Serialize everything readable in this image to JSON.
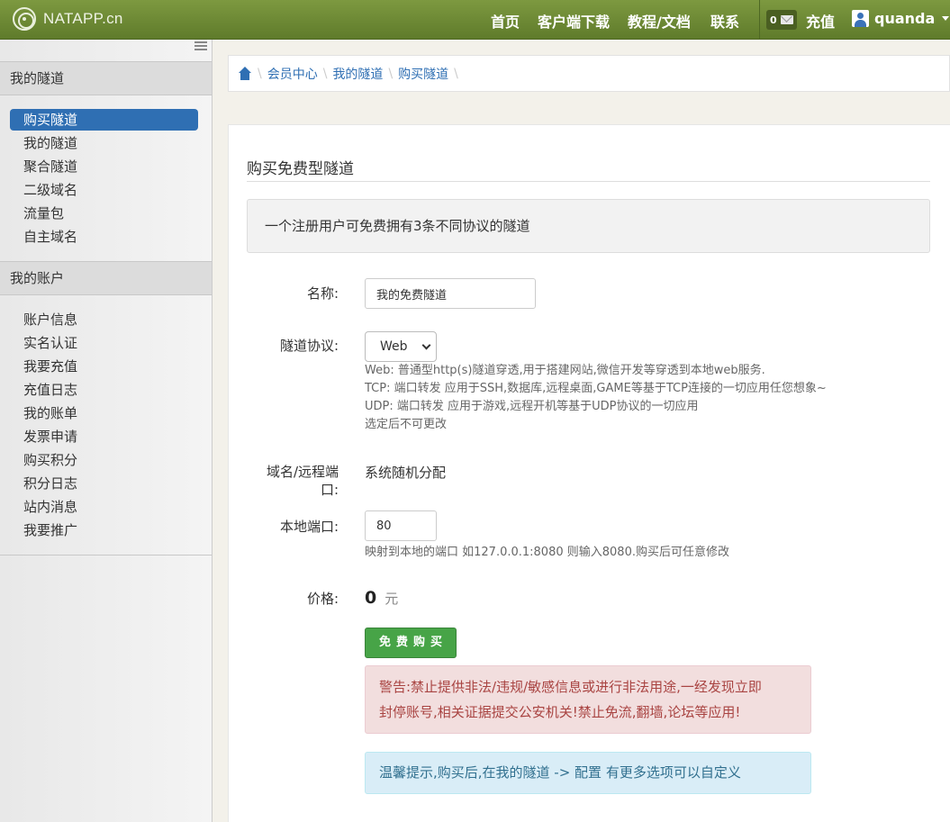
{
  "brand": {
    "name": "NATAPP.cn"
  },
  "topnav": {
    "links": [
      "首页",
      "客户端下载",
      "教程/文档",
      "联系"
    ],
    "message_count": "0",
    "recharge": "充值",
    "username": "quanda"
  },
  "sidebar": {
    "tunnel_section": "我的隧道",
    "tunnel_items": [
      "购买隧道",
      "我的隧道",
      "聚合隧道",
      "二级域名",
      "流量包",
      "自主域名"
    ],
    "account_section": "我的账户",
    "account_items": [
      "账户信息",
      "实名认证",
      "我要充值",
      "充值日志",
      "我的账单",
      "发票申请",
      "购买积分",
      "积分日志",
      "站内消息",
      "我要推广"
    ]
  },
  "breadcrumb": [
    "会员中心",
    "我的隧道",
    "购买隧道"
  ],
  "page": {
    "title": "购买免费型隧道",
    "notice": "一个注册用户可免费拥有3条不同协议的隧道"
  },
  "form": {
    "name_label": "名称:",
    "name_value": "我的免费隧道",
    "protocol_label": "隧道协议:",
    "protocol_value": "Web",
    "protocol_help": [
      "Web: 普通型http(s)隧道穿透,用于搭建网站,微信开发等穿透到本地web服务.",
      "TCP: 端口转发 应用于SSH,数据库,远程桌面,GAME等基于TCP连接的一切应用任您想象~",
      "UDP: 端口转发 应用于游戏,远程开机等基于UDP协议的一切应用",
      "选定后不可更改"
    ],
    "domain_label_line1": "域名/远程端",
    "domain_label_line2": "口:",
    "domain_value": "系统随机分配",
    "port_label": "本地端口:",
    "port_value": "80",
    "port_help": "映射到本地的端口 如127.0.0.1:8080 则输入8080.购买后可任意修改",
    "price_label": "价格:",
    "price_value": "0",
    "price_unit": "元",
    "buy_button": "免费购买"
  },
  "alerts": {
    "warning_line1": "警告:禁止提供非法/违规/敏感信息或进行非法用途,一经发现立即",
    "warning_line2": "封停账号,相关证据提交公安机关!禁止免流,翻墙,论坛等应用!",
    "tip": "温馨提示,购买后,在我的隧道 -> 配置 有更多选项可以自定义"
  },
  "colors": {
    "nav_green": "#6f8b35",
    "primary_blue": "#2f6fb3",
    "success_green": "#47a447",
    "danger_bg": "#f2dede",
    "info_bg": "#d9edf7"
  }
}
